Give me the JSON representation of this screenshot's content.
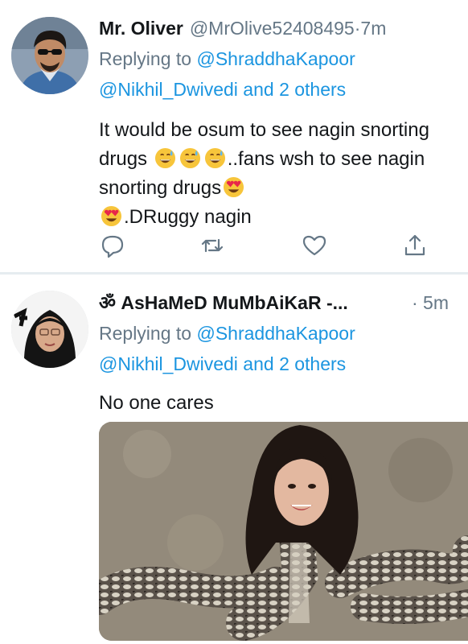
{
  "tweets": [
    {
      "name": "Mr. Oliver",
      "handle": "@MrOlive52408495",
      "separator": "·",
      "time": "7m",
      "replying_prefix": "Replying to ",
      "replying_mention1": "@ShraddhaKapoor",
      "replying_mention2": "@Nikhil_Dwivedi",
      "replying_and": " and ",
      "replying_others": "2 others",
      "text_part1": "It would be osum to see nagin snorting drugs",
      "text_part2": "..fans wsh to see nagin snorting drugs",
      "text_part3": ".DRuggy nagin",
      "emojis": [
        "grinning-sweat-emoji",
        "heart-eyes-emoji"
      ],
      "actions": [
        "reply-icon",
        "retweet-icon",
        "like-icon",
        "share-icon"
      ]
    },
    {
      "name": "ॐ AsHaMeD MuMbAiKaR -...",
      "separator": "·",
      "time": "5m",
      "replying_prefix": "Replying to ",
      "replying_mention1": "@ShraddhaKapoor",
      "replying_mention2": "@Nikhil_Dwivedi",
      "replying_and": " and ",
      "replying_others": "2 others",
      "text": "No one cares",
      "media": "snake-with-woman-face-photo"
    }
  ],
  "colors": {
    "link": "#1b95e0",
    "secondary": "#657786",
    "text": "#14171a",
    "divider": "#e6ecf0"
  }
}
